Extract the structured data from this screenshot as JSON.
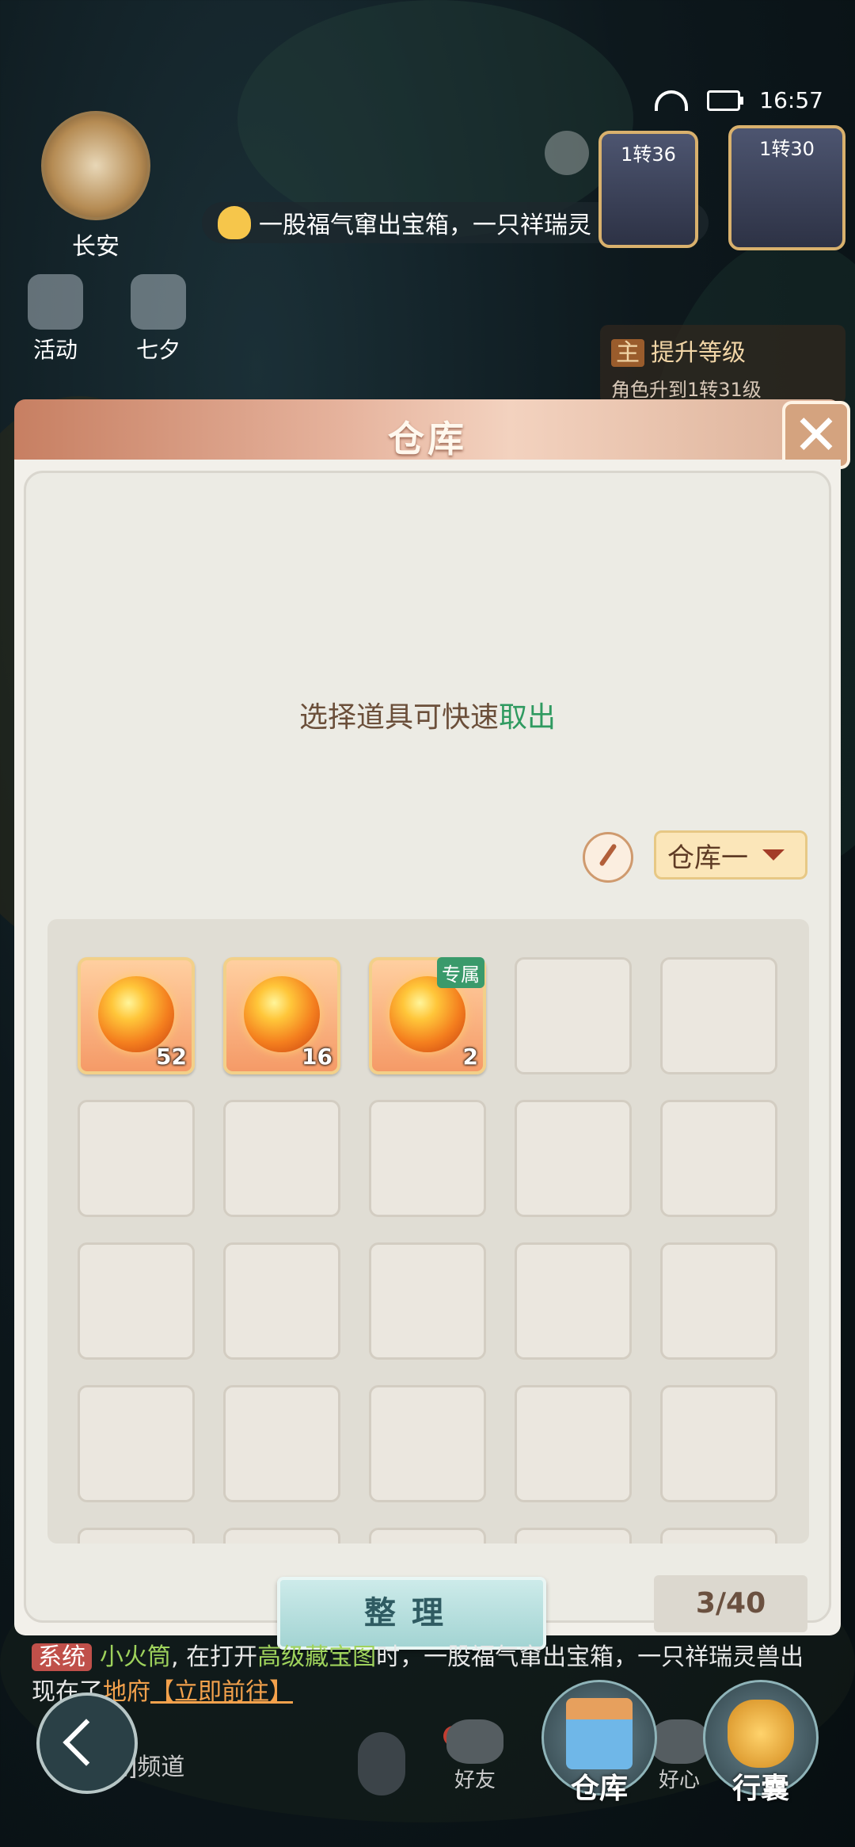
{
  "status_bar": {
    "time": "16:57"
  },
  "location": {
    "name": "长安"
  },
  "left_buttons": [
    {
      "label": "活动"
    },
    {
      "label": "七夕"
    }
  ],
  "broadcast": {
    "text": "一股福气窜出宝箱，一只祥瑞灵"
  },
  "portraits": [
    {
      "level": "1转36"
    },
    {
      "level": "1转30"
    }
  ],
  "quest": {
    "title": "提升等级",
    "badge": "主",
    "desc": "角色升到1转31级"
  },
  "warehouse": {
    "title": "仓库",
    "hint_prefix": "选择道具可快速",
    "hint_highlight": "取出",
    "dropdown_value": "仓库一",
    "sort_label": "整理",
    "capacity": "3/40",
    "items": [
      {
        "qty": "52",
        "tag": ""
      },
      {
        "qty": "16",
        "tag": ""
      },
      {
        "qty": "2",
        "tag": "专属"
      }
    ]
  },
  "chat": {
    "system_tag": "系统",
    "name": "小火筒",
    "p1": "在打开",
    "map": "高级藏宝图",
    "p2": "时，一股福气窜出宝箱，一只祥瑞灵兽出现在了",
    "location": "地府",
    "go": "【立即前往】",
    "channel": "[系统]频道"
  },
  "bottom": {
    "friend": "好友",
    "heart": "好心",
    "warehouse_btn": "仓库",
    "bag_btn": "行囊"
  }
}
